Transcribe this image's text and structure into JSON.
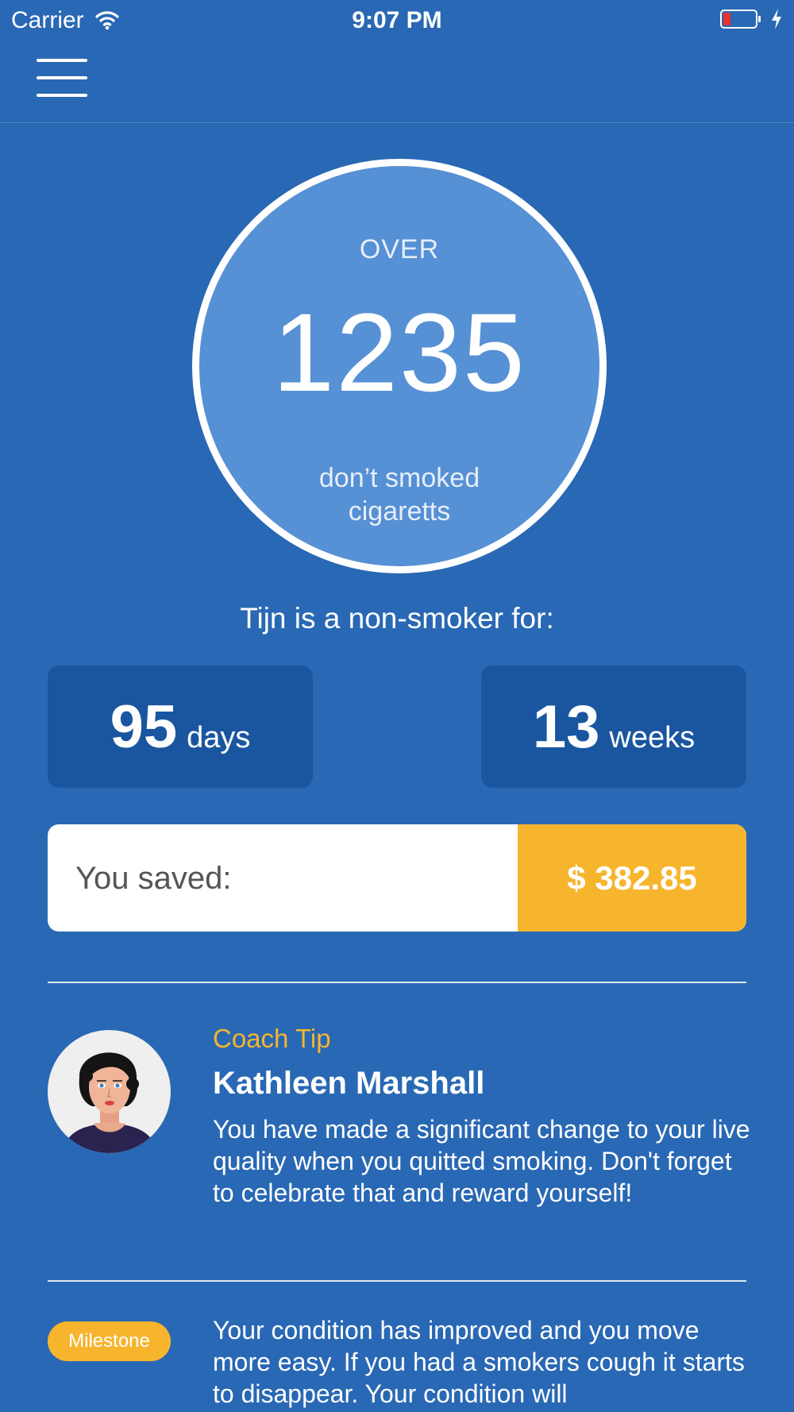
{
  "status_bar": {
    "carrier": "Carrier",
    "time": "9:07 PM",
    "icons": [
      "wifi-icon",
      "battery-icon",
      "charging-bolt-icon"
    ]
  },
  "nav": {
    "menu_icon": "hamburger-menu-icon"
  },
  "counter": {
    "over_label": "OVER",
    "count": "1235",
    "caption": "don’t smoked cigaretts"
  },
  "nonsmoker_label": "Tijn is a non-smoker for:",
  "stats": [
    {
      "value": "95",
      "unit": "days"
    },
    {
      "value": "13",
      "unit": "weeks"
    }
  ],
  "savings": {
    "label": "You saved:",
    "amount": "$ 382.85"
  },
  "coach": {
    "label": "Coach Tip",
    "name": "Kathleen Marshall",
    "text": "You have made a significant change to your live quality when you quitted smoking. Don't forget to celebrate that and reward yourself!"
  },
  "milestone": {
    "badge": "Milestone",
    "text": "Your condition has improved and you move more easy. If you had a smokers cough it starts to disappear. Your condition will"
  },
  "colors": {
    "background": "#2968b4",
    "circle_fill": "#5690d5",
    "stat_box": "#1a56a0",
    "accent": "#f7b52e"
  }
}
